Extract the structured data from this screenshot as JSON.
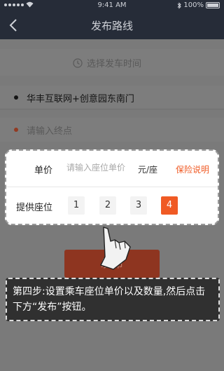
{
  "status": {
    "time": "9:41 AM",
    "battery": "100%"
  },
  "nav": {
    "title": "发布路线"
  },
  "schedule": {
    "label": "选择发车时间"
  },
  "route": {
    "start": "华丰互联网+创意园东南门",
    "end_placeholder": "请输入终点"
  },
  "price": {
    "label": "单价",
    "placeholder": "请输入座位单价",
    "unit": "元/座",
    "insurance_link": "保险说明"
  },
  "seats": {
    "label": "提供座位",
    "options": [
      "1",
      "2",
      "3",
      "4"
    ],
    "selected": "4"
  },
  "publish": {
    "label": "发布"
  },
  "instruction": {
    "text": "第四步:设置乘车座位单价以及数量,然后点击下方“发布”按钮。"
  },
  "colors": {
    "nav_bg": "#262c38",
    "accent": "#f05a24",
    "overlay": "#7a7a7a"
  }
}
